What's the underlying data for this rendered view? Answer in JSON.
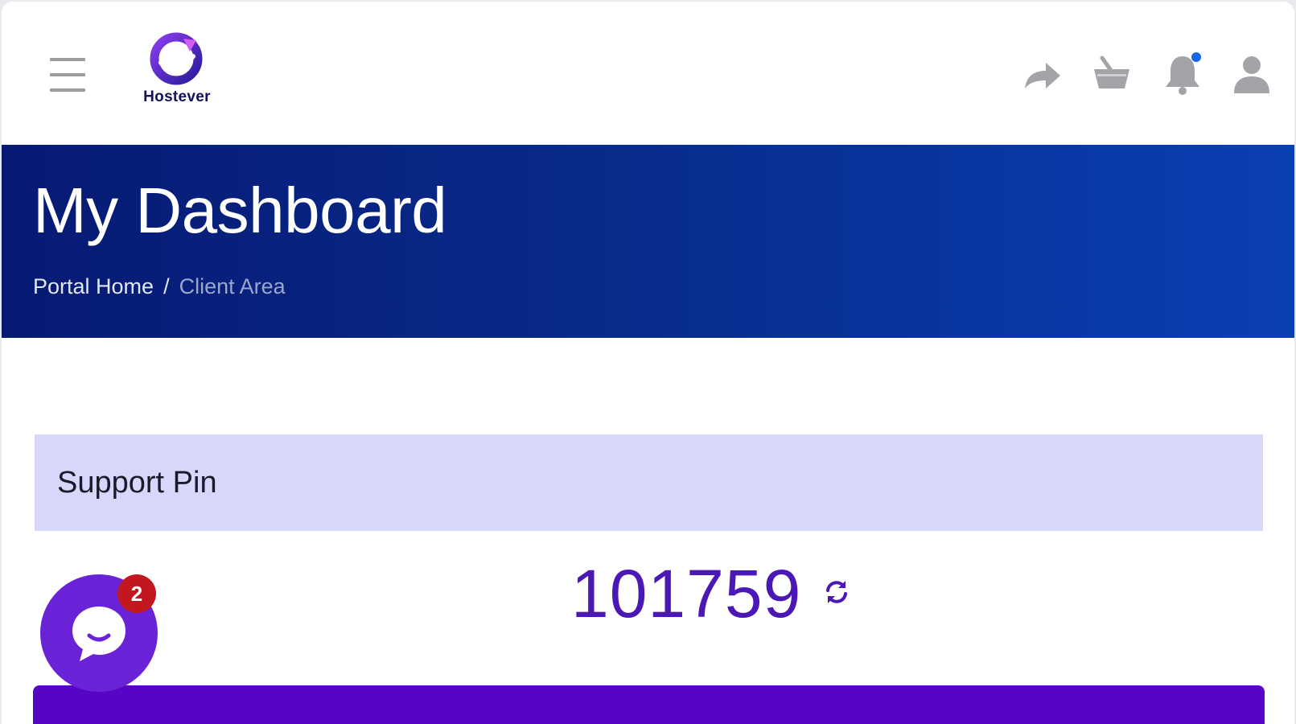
{
  "header": {
    "brand_name": "Hostever",
    "icons": [
      "menu-icon",
      "share-icon",
      "basket-icon",
      "bell-icon",
      "user-icon"
    ],
    "notification_indicator": true
  },
  "banner": {
    "title": "My Dashboard",
    "breadcrumb": {
      "home": "Portal Home",
      "separator": "/",
      "current": "Client Area"
    }
  },
  "support_pin": {
    "title": "Support Pin",
    "pin": "101759",
    "refresh_icon": "refresh-icon"
  },
  "chat": {
    "icon": "chat-bubble-icon",
    "unread_count": "2"
  },
  "colors": {
    "banner_start": "#061a73",
    "banner_end": "#0a3fb3",
    "card_header_bg": "#d7d7fb",
    "pin_text": "#4b17b5",
    "primary_purple": "#5605c4",
    "chat_bg": "#6a22d6",
    "badge_red": "#c3171f",
    "notification_dot": "#1766e8",
    "icon_gray": "#9b9b9b"
  }
}
